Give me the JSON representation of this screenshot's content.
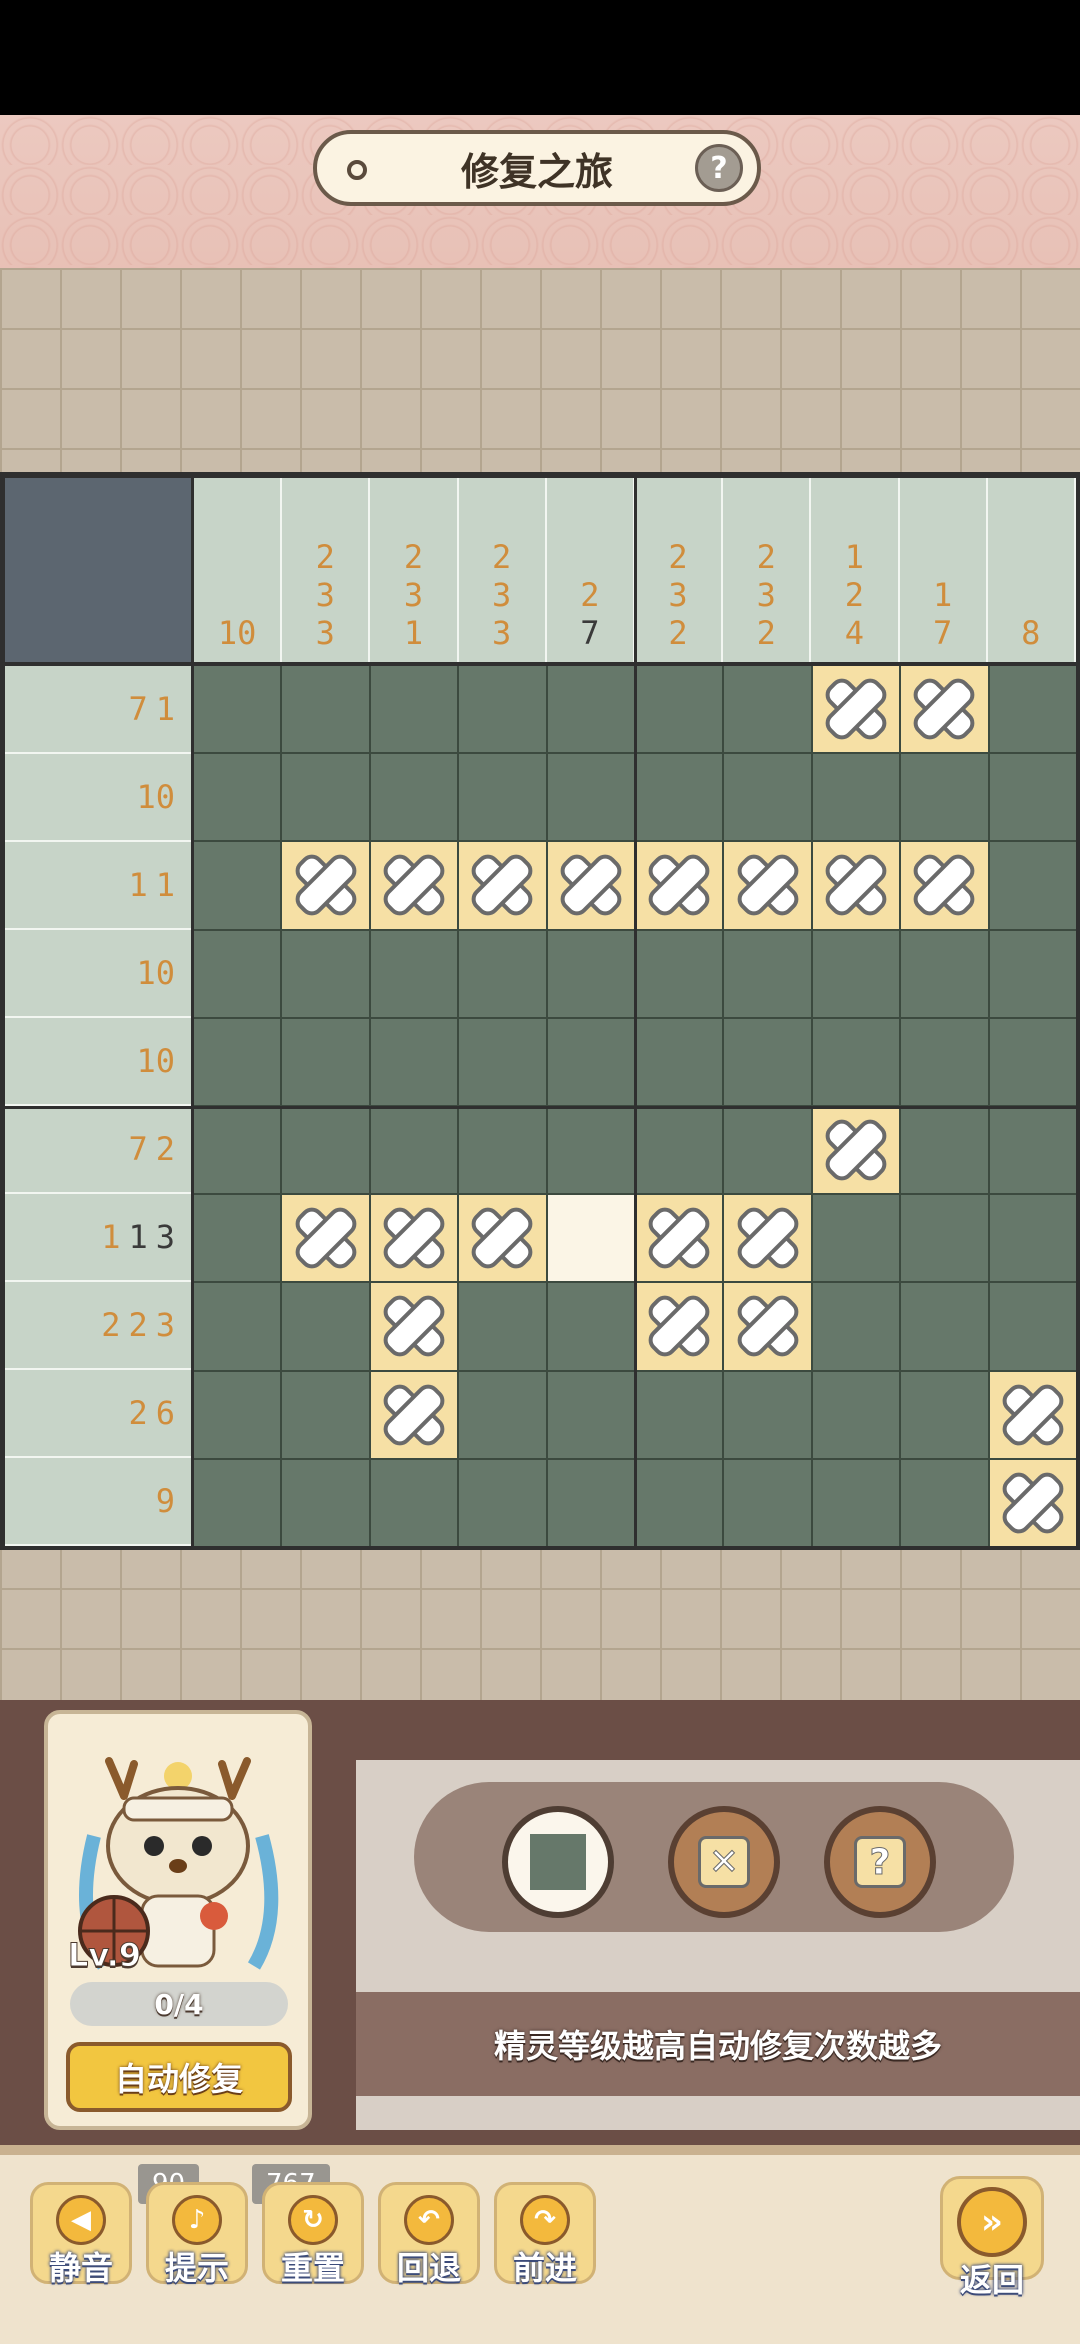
{
  "header": {
    "title": "修复之旅",
    "help_symbol": "?"
  },
  "puzzle": {
    "column_clues": [
      [
        {
          "v": "10",
          "dark": false
        }
      ],
      [
        {
          "v": "2",
          "dark": false
        },
        {
          "v": "3",
          "dark": false
        },
        {
          "v": "3",
          "dark": false
        }
      ],
      [
        {
          "v": "2",
          "dark": false
        },
        {
          "v": "3",
          "dark": false
        },
        {
          "v": "1",
          "dark": false
        }
      ],
      [
        {
          "v": "2",
          "dark": false
        },
        {
          "v": "3",
          "dark": false
        },
        {
          "v": "3",
          "dark": false
        }
      ],
      [
        {
          "v": "2",
          "dark": false
        },
        {
          "v": "7",
          "dark": true
        }
      ],
      [
        {
          "v": "2",
          "dark": false
        },
        {
          "v": "3",
          "dark": false
        },
        {
          "v": "2",
          "dark": false
        }
      ],
      [
        {
          "v": "2",
          "dark": false
        },
        {
          "v": "3",
          "dark": false
        },
        {
          "v": "2",
          "dark": false
        }
      ],
      [
        {
          "v": "1",
          "dark": false
        },
        {
          "v": "2",
          "dark": false
        },
        {
          "v": "4",
          "dark": false
        }
      ],
      [
        {
          "v": "1",
          "dark": false
        },
        {
          "v": "7",
          "dark": false
        }
      ],
      [
        {
          "v": "8",
          "dark": false
        }
      ]
    ],
    "row_clues": [
      [
        {
          "v": "7",
          "dark": false
        },
        {
          "v": "1",
          "dark": false
        }
      ],
      [
        {
          "v": "10",
          "dark": false
        }
      ],
      [
        {
          "v": "1",
          "dark": false
        },
        {
          "v": "1",
          "dark": false
        }
      ],
      [
        {
          "v": "10",
          "dark": false
        }
      ],
      [
        {
          "v": "10",
          "dark": false
        }
      ],
      [
        {
          "v": "7",
          "dark": false
        },
        {
          "v": "2",
          "dark": false
        }
      ],
      [
        {
          "v": "1",
          "dark": false
        },
        {
          "v": "1",
          "dark": true
        },
        {
          "v": "3",
          "dark": true
        }
      ],
      [
        {
          "v": "2",
          "dark": false
        },
        {
          "v": "2",
          "dark": false
        },
        {
          "v": "3",
          "dark": false
        }
      ],
      [
        {
          "v": "2",
          "dark": false
        },
        {
          "v": "6",
          "dark": false
        }
      ],
      [
        {
          "v": "9",
          "dark": false
        }
      ]
    ],
    "cells": [
      "FFFFFFFXXF",
      "FFFFFFFFFF",
      "FXXXXXXXXF",
      "FFFFFFFFFF",
      "FFFFFFFFFF",
      "FFFFFFFXFF",
      "FXXXEXXFFF",
      "FFXFFXXFFF",
      "FFXFFFFFFX",
      "FFFFFFFFFX"
    ]
  },
  "sprite": {
    "level": "Lv.9",
    "progress": "0/4",
    "auto_button": "自动修复"
  },
  "tools": {
    "mark_symbol": "✕",
    "unknown_symbol": "?",
    "hint_text": "精灵等级越高自动修复次数越多"
  },
  "bottom": {
    "mute_label": "静音",
    "hint_label": "提示",
    "hint_count": "90",
    "reset_label": "重置",
    "reset_count": "767",
    "undo_label": "回退",
    "redo_label": "前进",
    "back_label": "返回"
  },
  "colors": {
    "filled_cell": "#66786a",
    "crossed_cell": "#f6e0a5",
    "clue_orange": "#d08d3c",
    "clue_bg": "#c7d4c8"
  }
}
